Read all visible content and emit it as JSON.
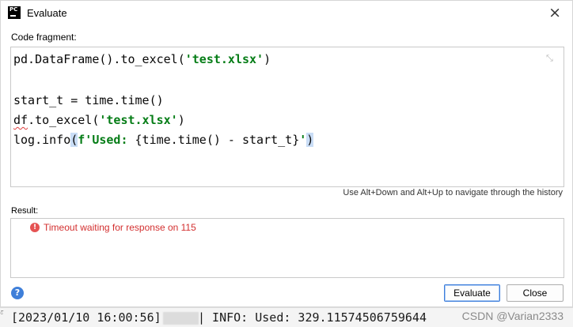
{
  "window": {
    "title": "Evaluate",
    "app_icon_text": "PC"
  },
  "code_fragment": {
    "label": "Code fragment:",
    "lines": [
      {
        "pre": "pd.DataFrame().to_excel(",
        "str": "'test.xlsx'",
        "post": ")"
      },
      {
        "text": "start_t = time.time()"
      },
      {
        "squiggle": "df",
        "pre": ".to_excel(",
        "str": "'test.xlsx'",
        "post": ")"
      },
      {
        "pre": "log.info",
        "hl_open": "(",
        "str_prefix": "f'Used: ",
        "inner": "{time.time() - start_t}",
        "str_close": "'",
        "hl_close": ")"
      }
    ]
  },
  "history_hint": "Use Alt+Down and Alt+Up to navigate through the history",
  "result": {
    "label": "Result:",
    "error_text": "Timeout waiting for response on 115"
  },
  "buttons": {
    "help": "?",
    "evaluate": "Evaluate",
    "close": "Close"
  },
  "console": {
    "lead_glyph": "ۚ",
    "timestamp_text": "[2023/01/10 16:00:56]",
    "log_text": "| INFO: Used: 329.11574506759644"
  },
  "watermark": "CSDN @Varian2333"
}
